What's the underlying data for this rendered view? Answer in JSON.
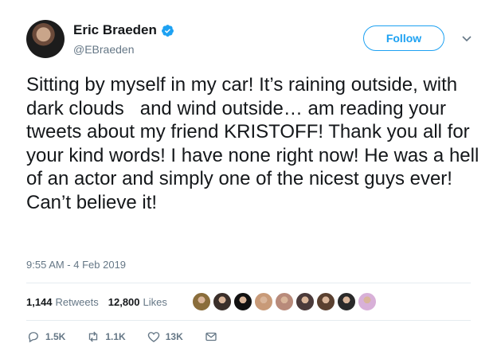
{
  "user": {
    "display_name": "Eric Braeden",
    "handle": "@EBraeden",
    "verified_icon": "verified-badge-icon"
  },
  "follow_button": {
    "label": "Follow"
  },
  "tweet": {
    "text": "Sitting by myself in my car! It’s raining outside, with dark clouds   and wind outside… am reading your tweets about my friend KRISTOFF! Thank you all for your kind words! I have none right now! He was a hell of an actor and simply one of the nicest guys ever! Can’t believe it!",
    "timestamp": "9:55 AM - 4 Feb 2019"
  },
  "stats": {
    "retweets_count": "1,144",
    "retweets_label": "Retweets",
    "likes_count": "12,800",
    "likes_label": "Likes"
  },
  "likers": [
    {
      "color": "#8a6d3b"
    },
    {
      "color": "#3a2f2a"
    },
    {
      "color": "#111111"
    },
    {
      "color": "#c89a78"
    },
    {
      "color": "#b88a7a"
    },
    {
      "color": "#4a3a3a"
    },
    {
      "color": "#5a4030"
    },
    {
      "color": "#2a2a2a"
    },
    {
      "color": "#d8b0d8"
    }
  ],
  "actions": {
    "reply_count": "1.5K",
    "retweet_count": "1.1K",
    "like_count": "13K"
  },
  "colors": {
    "accent": "#1da1f2",
    "muted": "#657786",
    "text": "#14171a"
  }
}
